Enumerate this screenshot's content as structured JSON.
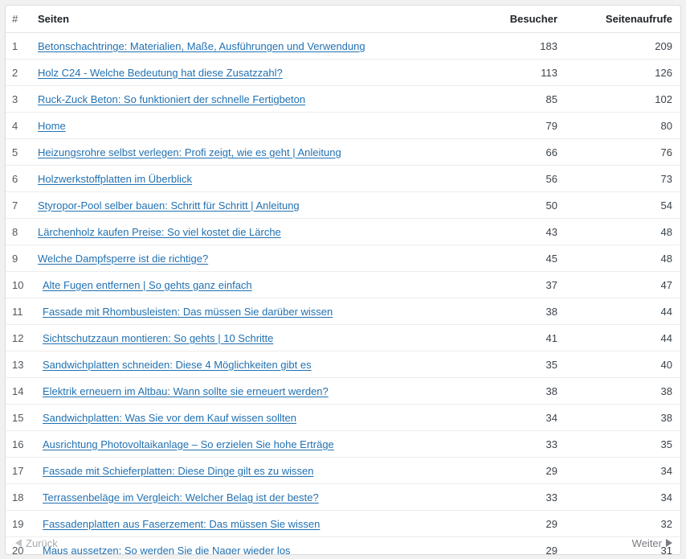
{
  "table": {
    "headers": {
      "num": "#",
      "page": "Seiten",
      "visitors": "Besucher",
      "views": "Seitenaufrufe"
    },
    "rows": [
      {
        "num": "1",
        "title": "Betonschachtringe: Materialien, Maße, Ausführungen und Verwendung",
        "visitors": "183",
        "views": "209"
      },
      {
        "num": "2",
        "title": "Holz C24 - Welche Bedeutung hat diese Zusatzzahl?",
        "visitors": "113",
        "views": "126"
      },
      {
        "num": "3",
        "title": "Ruck-Zuck Beton: So funktioniert der schnelle Fertigbeton",
        "visitors": "85",
        "views": "102"
      },
      {
        "num": "4",
        "title": "Home",
        "visitors": "79",
        "views": "80"
      },
      {
        "num": "5",
        "title": "Heizungsrohre selbst verlegen: Profi zeigt, wie es geht | Anleitung",
        "visitors": "66",
        "views": "76"
      },
      {
        "num": "6",
        "title": "Holzwerkstoffplatten im Überblick",
        "visitors": "56",
        "views": "73"
      },
      {
        "num": "7",
        "title": "Styropor-Pool selber bauen: Schritt für Schritt | Anleitung",
        "visitors": "50",
        "views": "54"
      },
      {
        "num": "8",
        "title": "Lärchenholz kaufen Preise: So viel kostet die Lärche",
        "visitors": "43",
        "views": "48"
      },
      {
        "num": "9",
        "title": "Welche Dampfsperre ist die richtige?",
        "visitors": "45",
        "views": "48"
      },
      {
        "num": "10",
        "title": "Alte Fugen entfernen | So gehts ganz einfach",
        "visitors": "37",
        "views": "47"
      },
      {
        "num": "11",
        "title": "Fassade mit Rhombusleisten: Das müssen Sie darüber wissen",
        "visitors": "38",
        "views": "44"
      },
      {
        "num": "12",
        "title": "Sichtschutzzaun montieren: So gehts | 10 Schritte",
        "visitors": "41",
        "views": "44"
      },
      {
        "num": "13",
        "title": "Sandwichplatten schneiden: Diese 4 Möglichkeiten gibt es",
        "visitors": "35",
        "views": "40"
      },
      {
        "num": "14",
        "title": "Elektrik erneuern im Altbau: Wann sollte sie erneuert werden?",
        "visitors": "38",
        "views": "38"
      },
      {
        "num": "15",
        "title": "Sandwichplatten: Was Sie vor dem Kauf wissen sollten",
        "visitors": "34",
        "views": "38"
      },
      {
        "num": "16",
        "title": "Ausrichtung Photovoltaikanlage – So erzielen Sie hohe Erträge",
        "visitors": "33",
        "views": "35"
      },
      {
        "num": "17",
        "title": "Fassade mit Schieferplatten: Diese Dinge gilt es zu wissen",
        "visitors": "29",
        "views": "34"
      },
      {
        "num": "18",
        "title": "Terrassenbeläge im Vergleich: Welcher Belag ist der beste?",
        "visitors": "33",
        "views": "34"
      },
      {
        "num": "19",
        "title": "Fassadenplatten aus Faserzement: Das müssen Sie wissen",
        "visitors": "29",
        "views": "32"
      },
      {
        "num": "20",
        "title": "Maus aussetzen: So werden Sie die Nager wieder los",
        "visitors": "29",
        "views": "31"
      }
    ]
  },
  "pagination": {
    "prev_label": "Zurück",
    "next_label": "Weiter"
  },
  "colors": {
    "link": "#2271b1",
    "text": "#3c434a",
    "disabled": "#a7aaad"
  },
  "icons": {
    "prev": "triangle-left-icon",
    "next": "triangle-right-icon"
  }
}
